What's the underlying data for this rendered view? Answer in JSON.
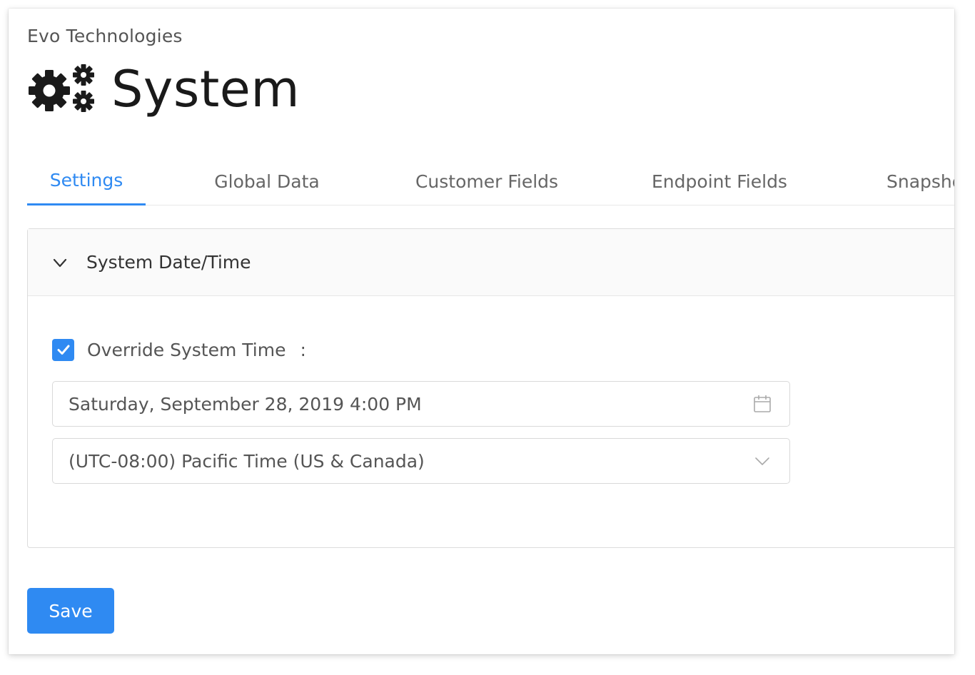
{
  "header": {
    "company": "Evo Technologies",
    "title": "System",
    "title_icon": "gears-icon"
  },
  "tabs": [
    {
      "label": "Settings",
      "active": true
    },
    {
      "label": "Global Data",
      "active": false
    },
    {
      "label": "Customer Fields",
      "active": false
    },
    {
      "label": "Endpoint Fields",
      "active": false
    },
    {
      "label": "Snapshots",
      "active": false
    }
  ],
  "panel": {
    "title": "System Date/Time",
    "expanded": true,
    "override": {
      "label": "Override System Time",
      "separator": ":",
      "checked": true
    },
    "datetime": {
      "value": "Saturday, September 28, 2019 4:00 PM",
      "icon": "calendar-icon"
    },
    "timezone": {
      "selected": "(UTC-08:00) Pacific Time (US & Canada)",
      "icon": "chevron-down-icon"
    }
  },
  "actions": {
    "save_label": "Save"
  },
  "colors": {
    "accent": "#2f8af2",
    "text": "#333333",
    "muted": "#666666",
    "border": "#d9d9d9"
  }
}
